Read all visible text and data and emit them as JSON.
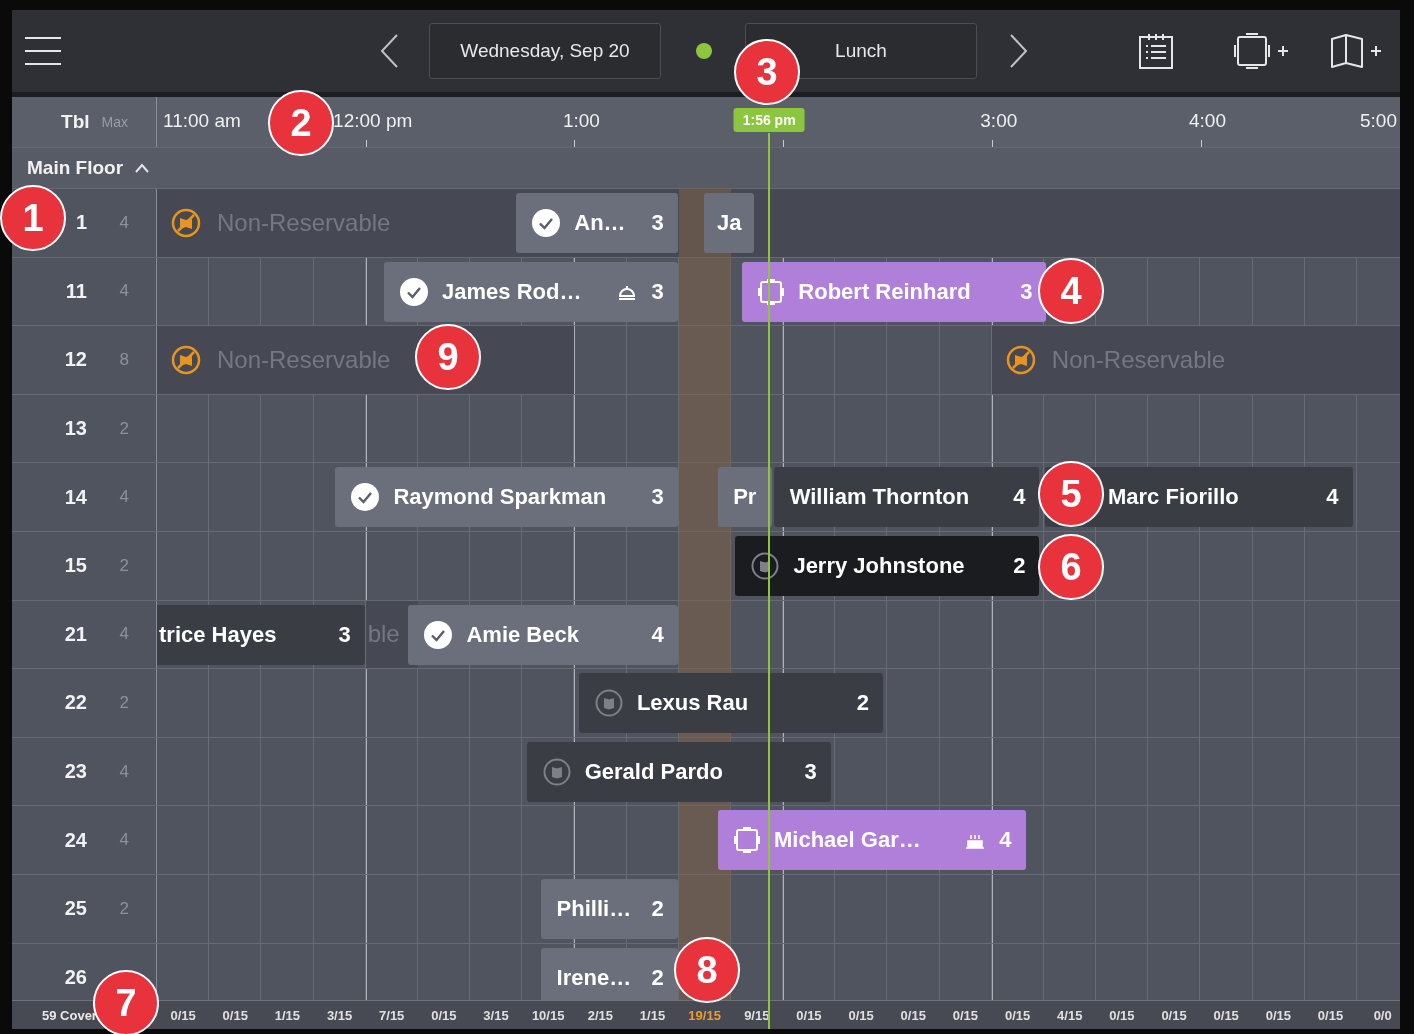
{
  "topbar": {
    "date": "Wednesday, Sep 20",
    "service": "Lunch"
  },
  "header": {
    "table_label": "Tbl",
    "max_label": "Max",
    "hours": [
      "11:00 am",
      "12:00 pm",
      "1:00",
      "3:00",
      "4:00",
      "5:00"
    ]
  },
  "now": {
    "label": "1:56 pm"
  },
  "section": {
    "name": "Main Floor",
    "expanded": true
  },
  "rows": [
    {
      "table": "1",
      "max": "4",
      "nonres": [
        {
          "kind": "full",
          "label": "Non-Reservable"
        }
      ],
      "bookings": [
        {
          "name": "An…",
          "covers": "3",
          "kind": "seated"
        },
        {
          "name": "Ja",
          "kind": "plain"
        }
      ]
    },
    {
      "table": "11",
      "max": "4",
      "nonres": [],
      "bookings": [
        {
          "name": "James Rod…",
          "covers": "3",
          "kind": "seated"
        },
        {
          "name": "Robert Reinhard",
          "covers": "3",
          "kind": "vip"
        }
      ]
    },
    {
      "table": "12",
      "max": "8",
      "nonres": [
        {
          "kind": "full",
          "label": "Non-Reservable"
        },
        {
          "kind": "full",
          "label": "Non-Reservable"
        }
      ],
      "bookings": []
    },
    {
      "table": "13",
      "max": "2",
      "nonres": [],
      "bookings": []
    },
    {
      "table": "14",
      "max": "4",
      "nonres": [],
      "bookings": [
        {
          "name": "Raymond Sparkman",
          "covers": "3",
          "kind": "seated"
        },
        {
          "name": "Pr",
          "kind": "plain"
        },
        {
          "name": "William Thornton",
          "covers": "4",
          "kind": "dark"
        },
        {
          "name": "Marc Fiorillo",
          "covers": "4",
          "kind": "dark"
        }
      ]
    },
    {
      "table": "15",
      "max": "2",
      "nonres": [],
      "bookings": [
        {
          "name": "Jerry Johnstone",
          "covers": "2",
          "kind": "arrived"
        }
      ]
    },
    {
      "table": "21",
      "max": "4",
      "nonres": [
        {
          "kind": "fragment",
          "label": "ble"
        }
      ],
      "bookings": [
        {
          "name": "trice Hayes",
          "covers": "3",
          "kind": "dark"
        },
        {
          "name": "Amie Beck",
          "covers": "4",
          "kind": "seated"
        }
      ]
    },
    {
      "table": "22",
      "max": "2",
      "nonres": [],
      "bookings": [
        {
          "name": "Lexus Rau",
          "covers": "2",
          "kind": "upcoming"
        }
      ]
    },
    {
      "table": "23",
      "max": "4",
      "nonres": [],
      "bookings": [
        {
          "name": "Gerald Pardo",
          "covers": "3",
          "kind": "upcoming"
        }
      ]
    },
    {
      "table": "24",
      "max": "4",
      "nonres": [],
      "bookings": [
        {
          "name": "Michael Gar…",
          "covers": "4",
          "kind": "vip"
        }
      ]
    },
    {
      "table": "25",
      "max": "2",
      "nonres": [],
      "bookings": [
        {
          "name": "Philli…",
          "covers": "2",
          "kind": "plain"
        }
      ]
    },
    {
      "table": "26",
      "nonres": [],
      "bookings": [
        {
          "name": "Irene…",
          "covers": "2",
          "kind": "plain"
        }
      ]
    }
  ],
  "status_bar": {
    "covers": "59 Cover",
    "counts": [
      {
        "text": "0/15",
        "alert": false
      },
      {
        "text": "0/15",
        "alert": false
      },
      {
        "text": "1/15",
        "alert": false
      },
      {
        "text": "3/15",
        "alert": false
      },
      {
        "text": "7/15",
        "alert": false
      },
      {
        "text": "0/15",
        "alert": false
      },
      {
        "text": "3/15",
        "alert": false
      },
      {
        "text": "10/15",
        "alert": false
      },
      {
        "text": "2/15",
        "alert": false
      },
      {
        "text": "1/15",
        "alert": false
      },
      {
        "text": "19/15",
        "alert": true
      },
      {
        "text": "9/15",
        "alert": false
      },
      {
        "text": "0/15",
        "alert": false
      },
      {
        "text": "0/15",
        "alert": false
      },
      {
        "text": "0/15",
        "alert": false
      },
      {
        "text": "0/15",
        "alert": false
      },
      {
        "text": "0/15",
        "alert": false
      },
      {
        "text": "4/15",
        "alert": false
      },
      {
        "text": "0/15",
        "alert": false
      },
      {
        "text": "0/15",
        "alert": false
      },
      {
        "text": "0/15",
        "alert": false
      },
      {
        "text": "0/15",
        "alert": false
      },
      {
        "text": "0/15",
        "alert": false
      },
      {
        "text": "0/0",
        "alert": false
      }
    ]
  },
  "callouts": [
    {
      "label": "1"
    },
    {
      "label": "2"
    },
    {
      "label": "3"
    },
    {
      "label": "4"
    },
    {
      "label": "5"
    },
    {
      "label": "6"
    },
    {
      "label": "7"
    },
    {
      "label": "8"
    },
    {
      "label": "9"
    }
  ]
}
